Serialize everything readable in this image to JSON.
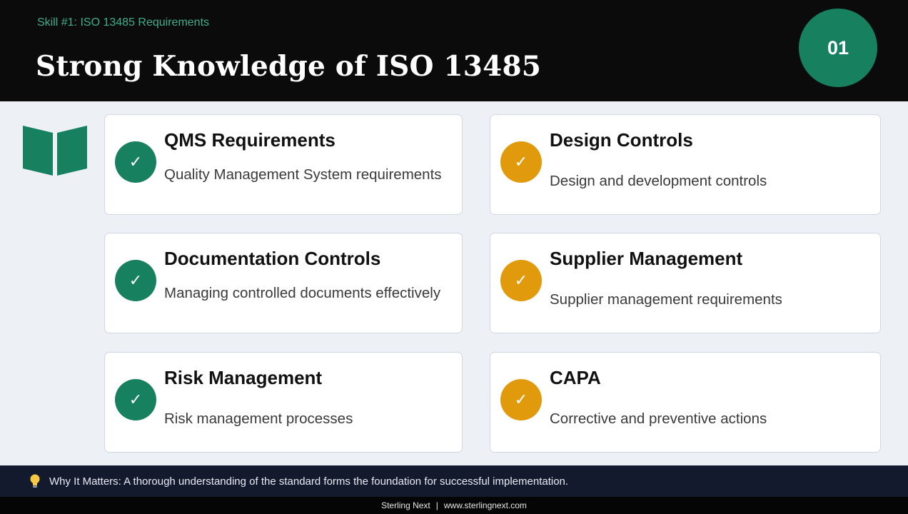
{
  "header": {
    "kicker": "Skill #1: ISO 13485 Requirements",
    "title": "Strong Knowledge of ISO 13485",
    "badge": "01"
  },
  "icons": {
    "book": "open-book-icon",
    "check": "checkmark-icon",
    "bulb": "lightbulb-icon"
  },
  "colors": {
    "accent_green": "#17805f",
    "accent_orange": "#e29a0d",
    "header_bg": "#0b0b0b",
    "note_bg": "#131a2d"
  },
  "cards": [
    {
      "title": "QMS Requirements",
      "desc": "Quality Management System requirements",
      "check": "✓"
    },
    {
      "title": "Design Controls",
      "desc": "Design and development controls",
      "check": "✓"
    },
    {
      "title": "Documentation Controls",
      "desc": "Managing controlled documents effectively",
      "check": "✓"
    },
    {
      "title": "Supplier Management",
      "desc": "Supplier management requirements",
      "check": "✓"
    },
    {
      "title": "Risk Management",
      "desc": "Risk management processes",
      "check": "✓"
    },
    {
      "title": "CAPA",
      "desc": "Corrective and preventive actions",
      "check": "✓"
    }
  ],
  "note": {
    "text": "Why It Matters: A thorough understanding of the standard forms the foundation for successful implementation."
  },
  "footer": {
    "brand": "Sterling Next",
    "separator": "|",
    "url": "www.sterlingnext.com"
  }
}
